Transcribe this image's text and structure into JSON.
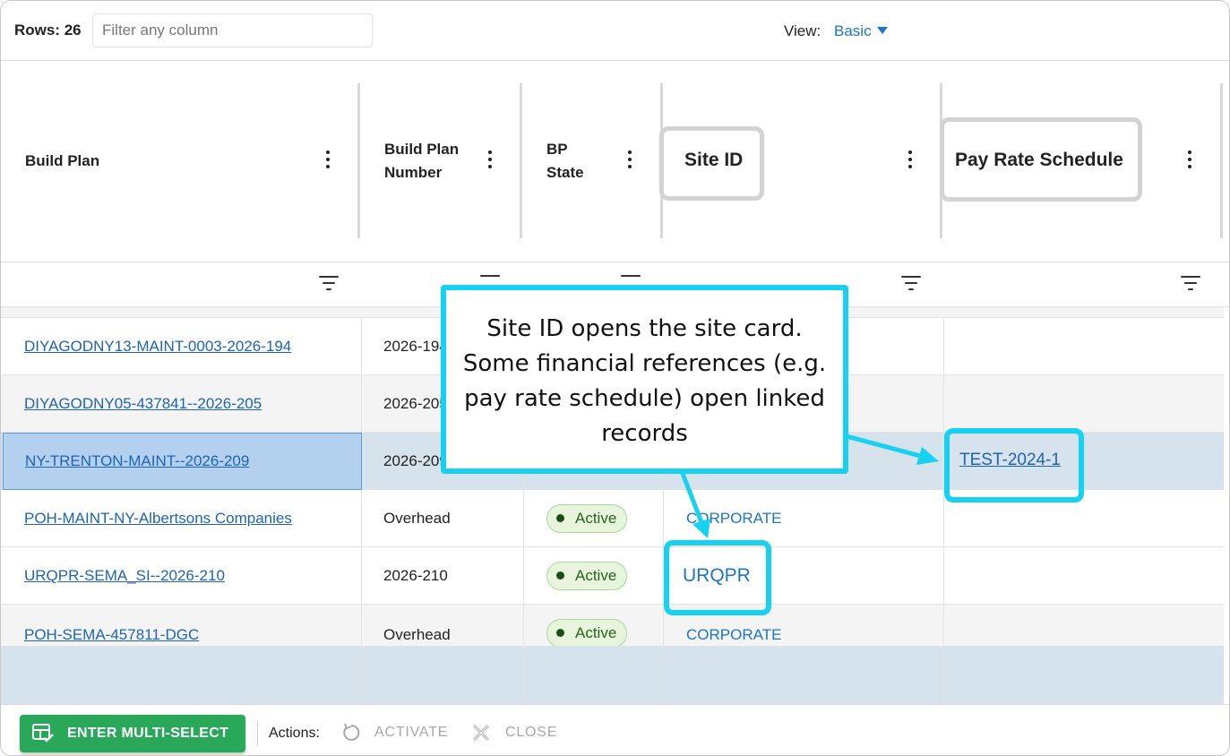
{
  "toolbar": {
    "rows_label": "Rows: 26",
    "filter_placeholder": "Filter any column",
    "view_label": "View:",
    "view_value": "Basic"
  },
  "columns": [
    {
      "key": "build_plan",
      "label": "Build Plan"
    },
    {
      "key": "build_plan_number",
      "label": "Build Plan Number"
    },
    {
      "key": "bp_state",
      "label": "BP State"
    },
    {
      "key": "site_id",
      "label": "Site ID"
    },
    {
      "key": "pay_rate_schedule",
      "label": "Pay Rate Schedule"
    }
  ],
  "rows": [
    {
      "build_plan": "DIYAGODNY13-MAINT-0003-2026-194",
      "number": "2026-194",
      "state": "",
      "site": "",
      "pay_rate": ""
    },
    {
      "build_plan": "DIYAGODNY05-437841--2026-205",
      "number": "2026-205",
      "state": "",
      "site": "",
      "pay_rate": ""
    },
    {
      "build_plan": "NY-TRENTON-MAINT--2026-209",
      "number": "2026-209",
      "state": "",
      "site": "",
      "pay_rate": "TEST-2024-1"
    },
    {
      "build_plan": "POH-MAINT-NY-Albertsons Companies",
      "number": "Overhead",
      "state": "Active",
      "site": "CORPORATE",
      "pay_rate": ""
    },
    {
      "build_plan": "URQPR-SEMA_SI--2026-210",
      "number": "2026-210",
      "state": "Active",
      "site": "URQPR",
      "pay_rate": ""
    },
    {
      "build_plan": "POH-SEMA-457811-DGC",
      "number": "Overhead",
      "state": "Active",
      "site": "CORPORATE",
      "pay_rate": ""
    }
  ],
  "bottombar": {
    "multi_select_label": "ENTER MULTI-SELECT",
    "actions_label": "Actions:",
    "activate_label": "ACTIVATE",
    "close_label": "CLOSE"
  },
  "callout": {
    "text": "Site ID opens the site card. Some financial references (e.g. pay rate schedule) open linked records"
  },
  "colors": {
    "accent": "#1e74c8",
    "link": "#1e64b4",
    "callout_border": "#16d1f0",
    "primary_button": "#2aa85a",
    "selected_row": "#d6e2ec",
    "selected_cell": "#b3d1ee",
    "active_badge_bg": "#e6f5dc"
  }
}
